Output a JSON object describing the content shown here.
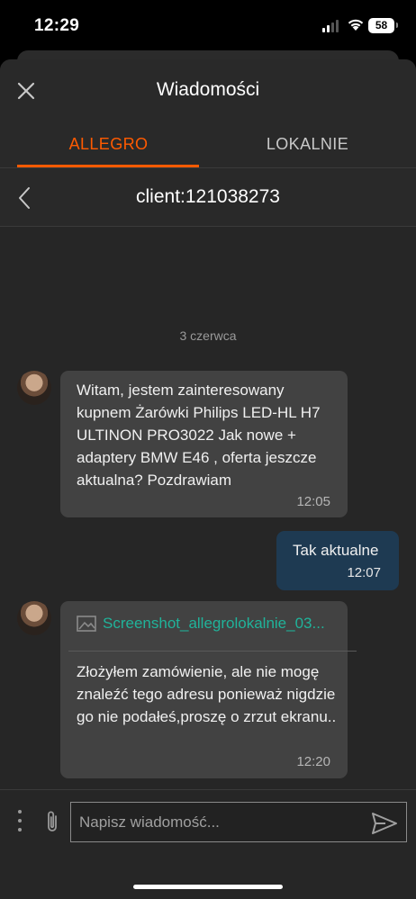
{
  "status_bar": {
    "time": "12:29",
    "battery": "58"
  },
  "header": {
    "title": "Wiadomości",
    "close_icon": "close-icon"
  },
  "tabs": [
    {
      "label": "ALLEGRO",
      "active": true
    },
    {
      "label": "LOKALNIE",
      "active": false
    }
  ],
  "conversation": {
    "title": "client:121038273"
  },
  "messages": {
    "date_separator": "3 czerwca",
    "items": [
      {
        "direction": "incoming",
        "text": "Witam, jestem zainteresowany kupnem Żarówki Philips LED-HL H7 ULTINON PRO3022 Jak nowe + adaptery BMW E46 , oferta jeszcze aktualna? Pozdrawiam",
        "time": "12:05"
      },
      {
        "direction": "outgoing",
        "text": "Tak aktualne",
        "time": "12:07"
      },
      {
        "direction": "incoming",
        "attachment": "Screenshot_allegrolokalnie_03...",
        "text": "Złożyłem zamówienie, ale nie mogę znaleźć tego adresu ponieważ nigdzie go nie podałeś,proszę o zrzut ekranu..",
        "time": "12:20"
      }
    ]
  },
  "composer": {
    "placeholder": "Napisz wiadomość..."
  },
  "colors": {
    "accent": "#ff5a00",
    "outgoing_bubble": "#1e3a52",
    "incoming_bubble": "#424242",
    "link": "#20b39a"
  }
}
